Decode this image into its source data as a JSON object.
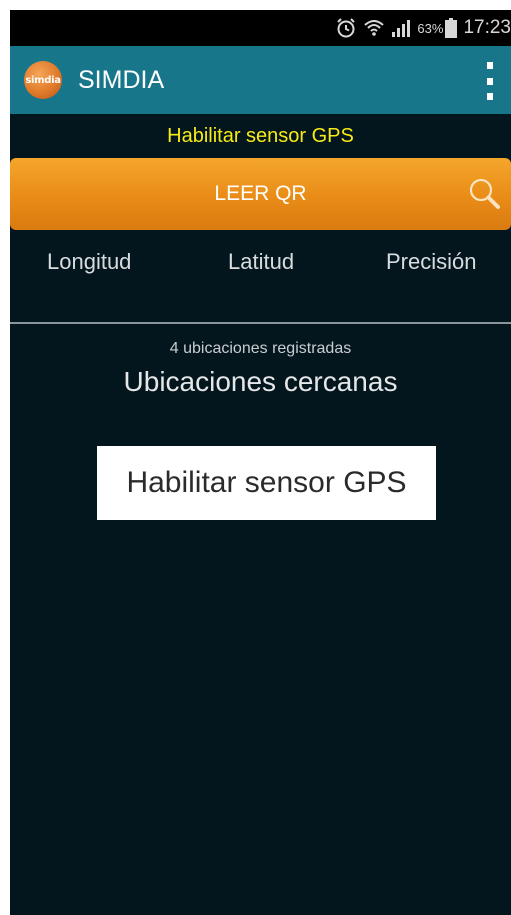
{
  "status_bar": {
    "icons": [
      "alarm-icon",
      "wifi-icon",
      "signal-icon",
      "battery-icon"
    ],
    "battery_percent": "63%",
    "time": "17:23"
  },
  "app_bar": {
    "logo_text": "simdia",
    "title": "SIMDIA",
    "menu_icon": "overflow-menu-icon"
  },
  "gps_banner": {
    "label": "Habilitar sensor GPS",
    "color": "#f7ea16"
  },
  "qr_button": {
    "label": "LEER QR",
    "icon": "search-icon",
    "color": "#e98c17"
  },
  "coords": {
    "columns": [
      "Longitud",
      "Latitud",
      "Precisión"
    ]
  },
  "locations": {
    "count_text": "4 ubicaciones registradas",
    "title": "Ubicaciones cercanas"
  },
  "enable_gps_button": {
    "label": "Habilitar sensor GPS"
  },
  "colors": {
    "background": "#03161d",
    "app_bar": "#17768a",
    "accent_orange": "#e98c17"
  }
}
